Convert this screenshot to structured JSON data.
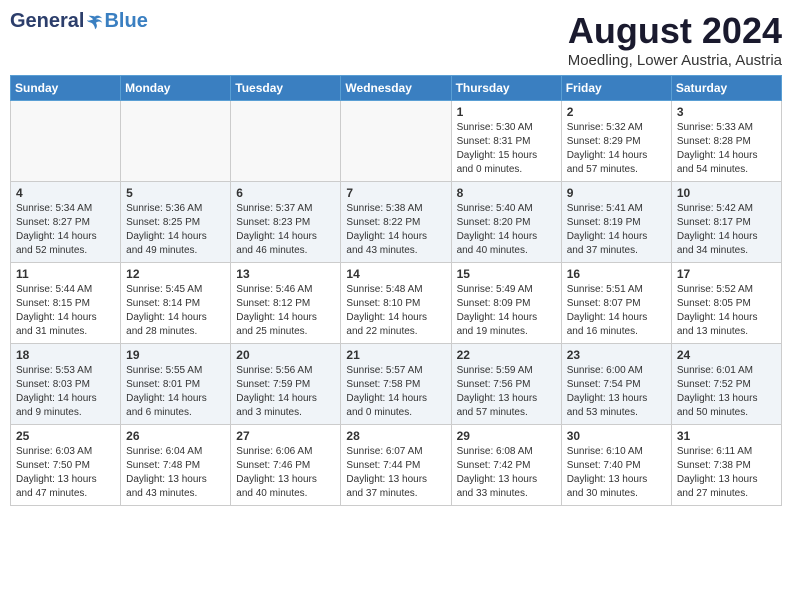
{
  "header": {
    "logo_general": "General",
    "logo_blue": "Blue",
    "month_year": "August 2024",
    "location": "Moedling, Lower Austria, Austria"
  },
  "days_of_week": [
    "Sunday",
    "Monday",
    "Tuesday",
    "Wednesday",
    "Thursday",
    "Friday",
    "Saturday"
  ],
  "weeks": [
    [
      {
        "day": "",
        "content": ""
      },
      {
        "day": "",
        "content": ""
      },
      {
        "day": "",
        "content": ""
      },
      {
        "day": "",
        "content": ""
      },
      {
        "day": "1",
        "content": "Sunrise: 5:30 AM\nSunset: 8:31 PM\nDaylight: 15 hours\nand 0 minutes."
      },
      {
        "day": "2",
        "content": "Sunrise: 5:32 AM\nSunset: 8:29 PM\nDaylight: 14 hours\nand 57 minutes."
      },
      {
        "day": "3",
        "content": "Sunrise: 5:33 AM\nSunset: 8:28 PM\nDaylight: 14 hours\nand 54 minutes."
      }
    ],
    [
      {
        "day": "4",
        "content": "Sunrise: 5:34 AM\nSunset: 8:27 PM\nDaylight: 14 hours\nand 52 minutes."
      },
      {
        "day": "5",
        "content": "Sunrise: 5:36 AM\nSunset: 8:25 PM\nDaylight: 14 hours\nand 49 minutes."
      },
      {
        "day": "6",
        "content": "Sunrise: 5:37 AM\nSunset: 8:23 PM\nDaylight: 14 hours\nand 46 minutes."
      },
      {
        "day": "7",
        "content": "Sunrise: 5:38 AM\nSunset: 8:22 PM\nDaylight: 14 hours\nand 43 minutes."
      },
      {
        "day": "8",
        "content": "Sunrise: 5:40 AM\nSunset: 8:20 PM\nDaylight: 14 hours\nand 40 minutes."
      },
      {
        "day": "9",
        "content": "Sunrise: 5:41 AM\nSunset: 8:19 PM\nDaylight: 14 hours\nand 37 minutes."
      },
      {
        "day": "10",
        "content": "Sunrise: 5:42 AM\nSunset: 8:17 PM\nDaylight: 14 hours\nand 34 minutes."
      }
    ],
    [
      {
        "day": "11",
        "content": "Sunrise: 5:44 AM\nSunset: 8:15 PM\nDaylight: 14 hours\nand 31 minutes."
      },
      {
        "day": "12",
        "content": "Sunrise: 5:45 AM\nSunset: 8:14 PM\nDaylight: 14 hours\nand 28 minutes."
      },
      {
        "day": "13",
        "content": "Sunrise: 5:46 AM\nSunset: 8:12 PM\nDaylight: 14 hours\nand 25 minutes."
      },
      {
        "day": "14",
        "content": "Sunrise: 5:48 AM\nSunset: 8:10 PM\nDaylight: 14 hours\nand 22 minutes."
      },
      {
        "day": "15",
        "content": "Sunrise: 5:49 AM\nSunset: 8:09 PM\nDaylight: 14 hours\nand 19 minutes."
      },
      {
        "day": "16",
        "content": "Sunrise: 5:51 AM\nSunset: 8:07 PM\nDaylight: 14 hours\nand 16 minutes."
      },
      {
        "day": "17",
        "content": "Sunrise: 5:52 AM\nSunset: 8:05 PM\nDaylight: 14 hours\nand 13 minutes."
      }
    ],
    [
      {
        "day": "18",
        "content": "Sunrise: 5:53 AM\nSunset: 8:03 PM\nDaylight: 14 hours\nand 9 minutes."
      },
      {
        "day": "19",
        "content": "Sunrise: 5:55 AM\nSunset: 8:01 PM\nDaylight: 14 hours\nand 6 minutes."
      },
      {
        "day": "20",
        "content": "Sunrise: 5:56 AM\nSunset: 7:59 PM\nDaylight: 14 hours\nand 3 minutes."
      },
      {
        "day": "21",
        "content": "Sunrise: 5:57 AM\nSunset: 7:58 PM\nDaylight: 14 hours\nand 0 minutes."
      },
      {
        "day": "22",
        "content": "Sunrise: 5:59 AM\nSunset: 7:56 PM\nDaylight: 13 hours\nand 57 minutes."
      },
      {
        "day": "23",
        "content": "Sunrise: 6:00 AM\nSunset: 7:54 PM\nDaylight: 13 hours\nand 53 minutes."
      },
      {
        "day": "24",
        "content": "Sunrise: 6:01 AM\nSunset: 7:52 PM\nDaylight: 13 hours\nand 50 minutes."
      }
    ],
    [
      {
        "day": "25",
        "content": "Sunrise: 6:03 AM\nSunset: 7:50 PM\nDaylight: 13 hours\nand 47 minutes."
      },
      {
        "day": "26",
        "content": "Sunrise: 6:04 AM\nSunset: 7:48 PM\nDaylight: 13 hours\nand 43 minutes."
      },
      {
        "day": "27",
        "content": "Sunrise: 6:06 AM\nSunset: 7:46 PM\nDaylight: 13 hours\nand 40 minutes."
      },
      {
        "day": "28",
        "content": "Sunrise: 6:07 AM\nSunset: 7:44 PM\nDaylight: 13 hours\nand 37 minutes."
      },
      {
        "day": "29",
        "content": "Sunrise: 6:08 AM\nSunset: 7:42 PM\nDaylight: 13 hours\nand 33 minutes."
      },
      {
        "day": "30",
        "content": "Sunrise: 6:10 AM\nSunset: 7:40 PM\nDaylight: 13 hours\nand 30 minutes."
      },
      {
        "day": "31",
        "content": "Sunrise: 6:11 AM\nSunset: 7:38 PM\nDaylight: 13 hours\nand 27 minutes."
      }
    ]
  ]
}
